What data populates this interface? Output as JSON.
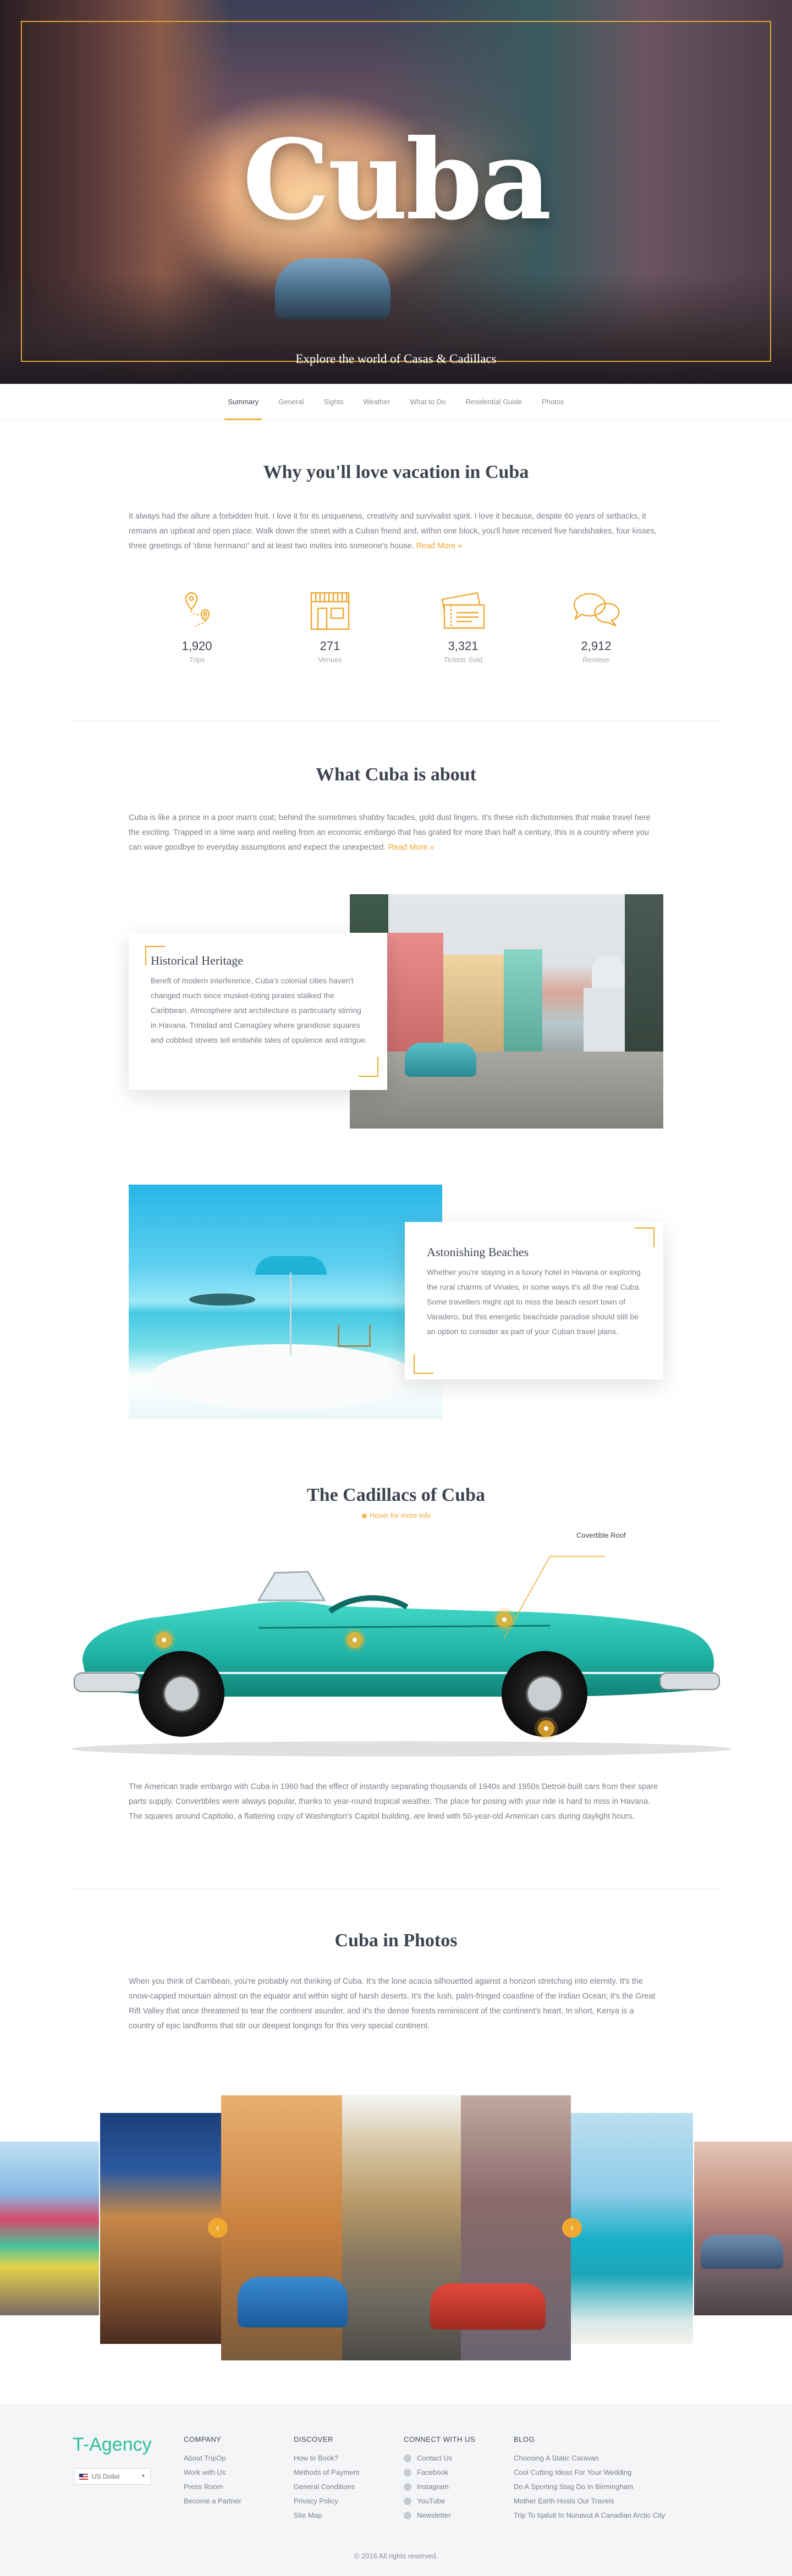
{
  "hero": {
    "title": "Cuba",
    "subtitle": "Explore the world of Casas & Cadillacs",
    "accent_color": "#e1a733"
  },
  "nav": {
    "items": [
      "Summary",
      "General",
      "Sights",
      "Weather",
      "What to Do",
      "Residential Guide",
      "Photos"
    ],
    "active": "Summary"
  },
  "why": {
    "title": "Why you'll love vacation in Cuba",
    "body": "It always had the allure a forbidden fruit. I love it for its uniqueness, creativity and survivalist spirit. I love it because, despite 60 years of setbacks, it remains an upbeat and open place. Walk down the street with a Cuban friend and, within one block, you'll have received five handshakes, four kisses, three greetings of 'dime hermano!' and at least two invites into someone's house.",
    "more": "Read More »"
  },
  "stats": [
    {
      "icon": "map-pin-route-icon",
      "value": "1,920",
      "label": "Trips"
    },
    {
      "icon": "storefront-icon",
      "value": "271",
      "label": "Venues"
    },
    {
      "icon": "tickets-icon",
      "value": "3,321",
      "label": "Tickets Sold"
    },
    {
      "icon": "chat-bubbles-icon",
      "value": "2,912",
      "label": "Reviews"
    }
  ],
  "about": {
    "title": "What Cuba is about",
    "body": "Cuba is like a prince in a poor man's coat; behind the sometimes shabby facades, gold dust lingers. It's these rich dichotomies that make travel here the exciting. Trapped in a time warp and reeling from an economic embargo that has grated for more than half a century, this is a country where you can wave goodbye to everyday assumptions and expect the unexpected.",
    "more": "Read More »"
  },
  "heritage": {
    "title": "Historical Heritage",
    "body": "Bereft of modern interference, Cuba's colonial cities haven't changed much since musket-toting pirates stalked the Caribbean. Atmosphere and architecture is particularly stirring in Havana, Trinidad and Camagüey where grandiose squares and cobbled streets tell erstwhile tales of opulence and intrigue."
  },
  "beaches": {
    "title": "Astonishing Beaches",
    "body": "Whether you're staying in a luxury hotel in Havana or exploring the rural charms of Vinales, in some ways it's all the real Cuba. Some travellers might opt to miss the beach resort town of Varadero, but this energetic beachside paradise should still be an option to consider as part of your Cuban travel plans."
  },
  "cadillacs": {
    "title": "The Cadillacs of Cuba",
    "hint": "Hover for more info",
    "callout": "Covertible Roof",
    "body": "The American trade embargo with Cuba in 1960 had the effect of instantly separating thousands of 1940s and 1950s Detroit-built cars from their spare parts supply. Convertibles were always popular, thanks to year-round tropical weather. The place for posing with your ride is hard to miss in Havana. The squares around Capitolio, a flattering copy of Washington's Capitol building, are lined with 50-year-old American cars during daylight hours."
  },
  "photos": {
    "title": "Cuba in Photos",
    "body": "When you think of Carribean, you're probably not thinking of Cuba. It's the lone acacia silhouetted against a horizon stretching into eternity. It's the snow-capped mountain almost on the equator and within sight of harsh deserts. It's the lush, palm-fringed coastline of the Indian Ocean; it's the Great Rift Valley that once threatened to tear the continent asunder, and it's the dense forests reminiscent of the continent's heart. In short, Kenya is a country of epic landforms that stir our deepest longings for this very special continent.",
    "prev": "‹",
    "next": "›"
  },
  "footer": {
    "logo": "T-Agency",
    "currency": "US Dollar",
    "company": {
      "title": "COMPANY",
      "items": [
        "About TripOp",
        "Work with Us",
        "Press Room",
        "Become a Partner"
      ]
    },
    "discover": {
      "title": "DISCOVER",
      "items": [
        "How to Book?",
        "Methods of Payment",
        "General Conditions",
        "Privacy Policy",
        "Site Map"
      ]
    },
    "connect": {
      "title": "CONNECT WITH US",
      "items": [
        "Contact Us",
        "Facebook",
        "Instagram",
        "YouTube",
        "Newsletter"
      ]
    },
    "blog": {
      "title": "BLOG",
      "items": [
        "Choosing A Static Caravan",
        "Cool Cutting Ideas For Your Wedding",
        "Do A Sporting Stag Do In Birmingham",
        "Mother Earth Hosts Our Travels",
        "Trip To Iqaluit In Nunavut A Canadian Arctic City"
      ]
    },
    "copyright": "© 2016 All rights reserved."
  }
}
